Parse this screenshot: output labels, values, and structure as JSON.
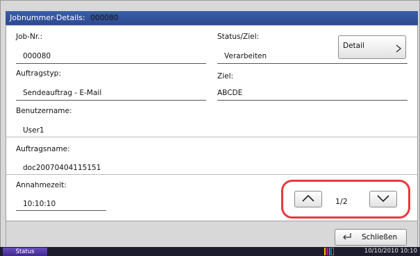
{
  "dialog": {
    "title_label": "Jobnummer-Details:",
    "title_value": "000080"
  },
  "fields": {
    "job_nr": {
      "label": "Job-Nr.:",
      "value": "000080"
    },
    "status": {
      "label": "Status/Ziel:",
      "value": "Verarbeiten"
    },
    "auftragstyp": {
      "label": "Auftragstyp:",
      "value": "Sendeauftrag - E-Mail"
    },
    "ziel": {
      "label": "Ziel:",
      "value": "ABCDE"
    },
    "benutzername": {
      "label": "Benutzername:",
      "value": "User1"
    },
    "auftragsname": {
      "label": "Auftragsname:",
      "value": "doc20070404115151"
    },
    "annahmezeit": {
      "label": "Annahmezeit:",
      "value": "10:10:10"
    }
  },
  "buttons": {
    "detail": "Detail",
    "close": "Schließen"
  },
  "pagination": {
    "indicator": "1/2",
    "highlight_color": "#e8383d"
  },
  "status_bar": {
    "status_label": "Status",
    "datetime": "10/10/2010  10:10"
  },
  "colors": {
    "title_bar": "#2c4a8f",
    "status_button": "#5a3fb0",
    "toner": [
      "#f2c500",
      "#d4007a",
      "#00a0d6",
      "#111111"
    ]
  },
  "icons": {
    "detail_chevron": "chevron-right-icon",
    "page_up": "chevron-up-icon",
    "page_down": "chevron-down-icon",
    "close": "return-arrow-icon"
  }
}
